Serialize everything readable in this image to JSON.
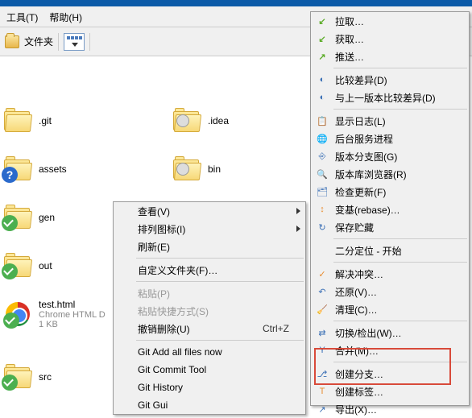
{
  "menubar": {
    "tools": "工具(T)",
    "help": "帮助(H)"
  },
  "toolbar": {
    "folders": "文件夹"
  },
  "files": [
    {
      "name": ".git",
      "type": "folder",
      "overlay": null
    },
    {
      "name": ".idea",
      "type": "folder",
      "overlay": "gray"
    },
    {
      "name": "assets",
      "type": "folder",
      "overlay": "question"
    },
    {
      "name": "bin",
      "type": "folder",
      "overlay": "gray"
    },
    {
      "name": "gen",
      "type": "folder",
      "overlay": "check"
    },
    {
      "name": "out",
      "type": "folder",
      "overlay": "check"
    },
    {
      "name": "test.html",
      "type": "chrome",
      "sub1": "Chrome HTML D",
      "sub2": "1 KB",
      "overlay": "check"
    },
    {
      "name": "src",
      "type": "folder",
      "overlay": "check"
    }
  ],
  "ctx1": [
    {
      "t": "查看(V)",
      "arrow": true
    },
    {
      "t": "排列图标(I)",
      "arrow": true
    },
    {
      "t": "刷新(E)"
    },
    {
      "sep": true
    },
    {
      "t": "自定义文件夹(F)…"
    },
    {
      "sep": true
    },
    {
      "t": "粘贴(P)",
      "disabled": true
    },
    {
      "t": "粘贴快捷方式(S)",
      "disabled": true
    },
    {
      "t": "撤销删除(U)",
      "shortcut": "Ctrl+Z"
    },
    {
      "sep": true
    },
    {
      "t": "Git Add all files now"
    },
    {
      "t": "Git Commit Tool"
    },
    {
      "t": "Git History"
    },
    {
      "t": "Git Gui"
    }
  ],
  "ctx2": [
    {
      "t": "拉取…",
      "ico": "↙",
      "cls": "green-arr"
    },
    {
      "t": "获取…",
      "ico": "↙",
      "cls": "green-arr"
    },
    {
      "t": "推送…",
      "ico": "↗",
      "cls": "green-arr"
    },
    {
      "sep": true
    },
    {
      "t": "比较差异(D)",
      "ico": "◐",
      "cls": "blue-i"
    },
    {
      "t": "与上一版本比较差异(D)",
      "ico": "◐",
      "cls": "blue-i"
    },
    {
      "sep": true
    },
    {
      "t": "显示日志(L)",
      "ico": "📋",
      "cls": "blue-i"
    },
    {
      "t": "后台服务进程",
      "ico": "🌐",
      "cls": "blue-i"
    },
    {
      "t": "版本分支图(G)",
      "ico": "⎆",
      "cls": "blue-i"
    },
    {
      "t": "版本库浏览器(R)",
      "ico": "🔍",
      "cls": "blue-i"
    },
    {
      "t": "检查更新(F)",
      "ico": "🗂",
      "cls": "blue-i"
    },
    {
      "t": "变基(rebase)…",
      "ico": "↕",
      "cls": "orange-i"
    },
    {
      "t": "保存贮藏",
      "ico": "↻",
      "cls": "blue-i"
    },
    {
      "sep": true
    },
    {
      "t": "二分定位 - 开始"
    },
    {
      "sep": true
    },
    {
      "t": "解决冲突…",
      "ico": "✓",
      "cls": "orange-i"
    },
    {
      "t": "还原(V)…",
      "ico": "↶",
      "cls": "blue-i"
    },
    {
      "t": "清理(C)…",
      "ico": "🧹",
      "cls": "red-i"
    },
    {
      "sep": true
    },
    {
      "t": "切换/检出(W)…",
      "ico": "⇄",
      "cls": "blue-i"
    },
    {
      "t": "合并(M)…",
      "ico": "Y",
      "cls": "blue-i"
    },
    {
      "sep": true
    },
    {
      "t": "创建分支…",
      "ico": "⎇",
      "cls": "blue-i"
    },
    {
      "t": "创建标签…",
      "ico": "T",
      "cls": "orange-i"
    },
    {
      "t": "导出(X)…",
      "ico": "↗",
      "cls": "blue-i"
    }
  ]
}
